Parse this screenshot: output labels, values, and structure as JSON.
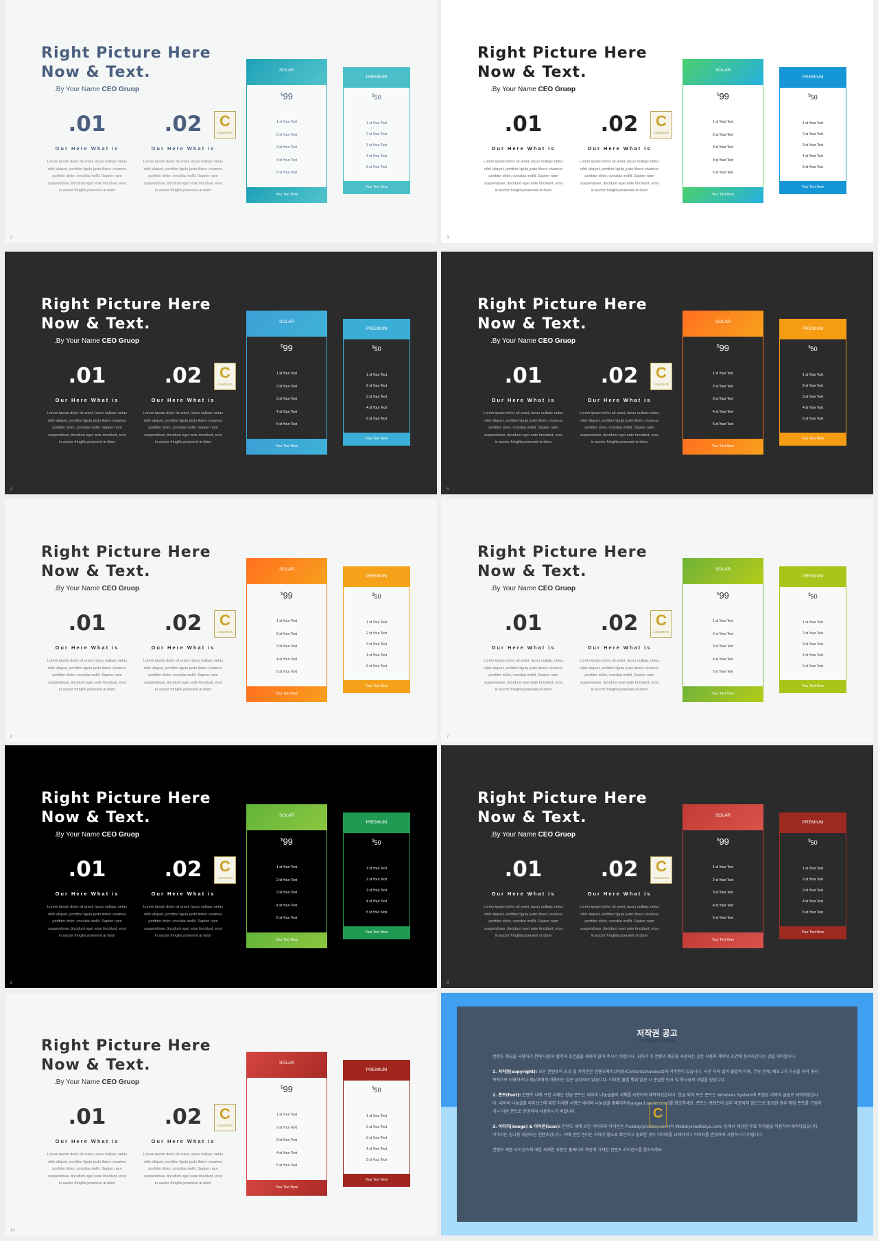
{
  "common": {
    "title_line1": "Right Picture Here",
    "title_line2": "Now & Text.",
    "byline_prefix": ".By Your Name ",
    "byline_bold": "CEO Gruop",
    "items": [
      {
        "number": ".01",
        "heading": "Our Here What is",
        "body": "Lorem ipsum dolor sit amet, lacus nullaac netus nibh aliquet, porttitor ligula justo libero vivamus porttitor dolor, conubia mollit. Sapien nam suspendisse, tincidunt eget ante tincidunt, eros in auctor fringilla praesent at diam"
      },
      {
        "number": ".02",
        "heading": "Our Here What is",
        "body": "Lorem ipsum dolor sit amet, lacus nullaac netus nibh aliquet, porttitor ligula justo libero vivamus porttitor dolor, conubia mollit. Sapien nam suspendisse, tincidunt eget ante tincidunt, eros in auctor fringilla praesent at diam"
      }
    ],
    "logo_letter": "C",
    "logo_text": "CONTENTS",
    "solar": {
      "name": "SOLAR",
      "currency": "$",
      "price": "99",
      "features": [
        "1 st Your Text",
        "2 st Your Text",
        "3 st Your Text",
        "4 st Your Text",
        "5 st Your Text"
      ],
      "footer": "Your Text Here"
    },
    "premium": {
      "name": "PREMIUM",
      "currency": "$",
      "price": "50",
      "features": [
        "1 st Your Text",
        "2 st Your Text",
        "3 st Your Text",
        "4 st Your Text",
        "5 st Your Text"
      ],
      "footer": "Your Text Here"
    }
  },
  "slides": [
    {
      "number": "2",
      "bg": "#f5f7f7",
      "title": "#4a5f7e",
      "text": "#4a5f7e",
      "body": "#666666",
      "card_bg": "#f8fafa",
      "solar": [
        "#1fa0b6",
        "#52c4cd"
      ],
      "premium": "#4bbfc7"
    },
    {
      "number": "3",
      "bg": "#ffffff",
      "title": "#222222",
      "text": "#222222",
      "body": "#444444",
      "card_bg": "#ffffff",
      "solar": [
        "#4ccf6e",
        "#26b0de"
      ],
      "premium": "#1596d6"
    },
    {
      "number": "4",
      "bg": "#2b2b2b",
      "title": "#ffffff",
      "text": "#ffffff",
      "body": "#dddddd",
      "card_bg": "#2b2b2b",
      "solar": [
        "#3c9fd6",
        "#3fb2d8"
      ],
      "premium": "#3aaed6"
    },
    {
      "number": "5",
      "bg": "#2b2b2b",
      "title": "#ffffff",
      "text": "#ffffff",
      "body": "#dddddd",
      "card_bg": "#2b2b2b",
      "solar": [
        "#ff6f1f",
        "#f8a11d"
      ],
      "premium": "#f59c12"
    },
    {
      "number": "6",
      "bg": "#f5f7f7",
      "title": "#333333",
      "text": "#333333",
      "body": "#555555",
      "card_bg": "#f8fafa",
      "solar": [
        "#ff6f1f",
        "#f8a11d"
      ],
      "premium": "#f5a21a"
    },
    {
      "number": "7",
      "bg": "#f5f7f7",
      "title": "#333333",
      "text": "#333333",
      "body": "#555555",
      "card_bg": "#f8fafa",
      "solar": [
        "#6fb23a",
        "#b6cc18"
      ],
      "premium": "#aac51a"
    },
    {
      "number": "8",
      "bg": "#000000",
      "title": "#ffffff",
      "text": "#ffffff",
      "body": "#dddddd",
      "card_bg": "#000000",
      "solar": [
        "#62b43a",
        "#8cc63f"
      ],
      "premium": "#1e9a52"
    },
    {
      "number": "9",
      "bg": "#2b2b2b",
      "title": "#ffffff",
      "text": "#ffffff",
      "body": "#dddddd",
      "card_bg": "#2b2b2b",
      "solar": [
        "#c23c36",
        "#d8534a"
      ],
      "premium": "#9c2a20"
    },
    {
      "number": "10",
      "bg": "#f5f7f7",
      "title": "#333333",
      "text": "#333333",
      "body": "#555555",
      "card_bg": "#f8fafa",
      "solar": [
        "#d5463f",
        "#a82a26"
      ],
      "premium": "#a0261f"
    }
  ],
  "copyright": {
    "title": "저작권 공고",
    "subtitle": "Copyright Notice",
    "intro": "컨텐츠 제공을 사용하기 전에 다음의 협약과 조건들을 세세히 읽어 주시기 바랍니다. 귀하가 이 컨텐츠 제공을 사용하는 것은 사용자 계약서 조건에 동의하신다는 것을 의미합니다.",
    "sections": [
      {
        "label": "1. 저작권(copyright):",
        "text": " 모든 컨텐츠의 소유 및 저작권은 컨텐츠메이크어웃(Contentsmakeout)에 저작권이 있습니다. 사전 허락 없이 불법적 이용, 무단 전재, 배포 2차 가공을 하여 영리 목적으로 이용하거나 제삼자에게 이용하는 것은 금지되어 있습니다. 이러한 불법 행위 발견 시 준엄한 민사 및 형사상의 처벌을 받습니다."
      },
      {
        "label": "2. 폰트(font):",
        "text": " 컨텐츠 내에 쓰인 서체는 한글 폰트는 네이버 나눔글꼴의 서체를 사용하여 제작되었습니다. 한글 외의 모든 폰트는 Windows System에 포함된 서체의 글꼴로 제작되었습니다. 네이버 나눔글꼴 라이선스에 대한 자세한 사항은 네이버 나눔글꼴 홈페이지(hangeul.naver.com)를 참조하세요. 폰트는 컨텐츠의 일부 제공되지 않으므로 필요한 경우 해당 폰트를 구입하거나 다른 폰트로 변경하여 사용하시기 바랍니다."
      },
      {
        "label": "3. 이미지(image) & 아이콘(icon):",
        "text": " 컨텐츠 내에 쓰인 이미지와 아이콘은 Pixabay(pixabay.com)와 Webalys(webalys.com) 등에서 제공한 무료 저작물을 이용하여 제작되었습니다. 이미지는 참고용 제공되는 컨텐츠입니다. 이에 관한 권리는 귀하가 별도로 확인하고 필요한 경우 이미지를 교체하거나 이미지를 변경하여 사용하시기 바랍니다."
      }
    ],
    "footer": "컨텐츠 제품 라이선스에 대한 자세한 사항은 홈페이지 하단에 기재된 컨텐츠 라이선스를 참조하세요.",
    "logo_letter": "C"
  }
}
